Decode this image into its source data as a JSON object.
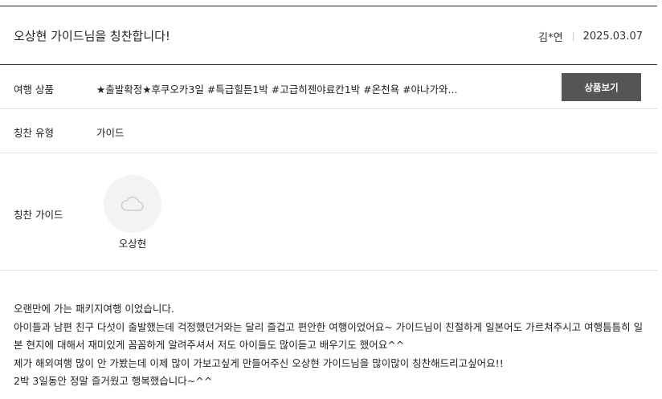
{
  "review": {
    "title": "오상현 가이드님을 칭찬합니다!",
    "author": "김*연",
    "date": "2025.03.07"
  },
  "details": {
    "product_label": "여행 상품",
    "product_value": "★출발확정★후쿠오카3일 #특급힐튼1박 #고급히젠야료칸1박 #온천욕 #야나가와...",
    "product_button": "상품보기",
    "type_label": "칭찬 유형",
    "type_value": "가이드",
    "guide_label": "칭찬 가이드",
    "guide_name": "오상현",
    "avatar_icon": "cloud-icon"
  },
  "content": {
    "lines": [
      "오랜만에 가는 패키지여행 이었습니다.",
      "아이들과 남편 친구 다섯이 출발했는데 걱정했던거와는 달리 즐겁고 편안한 여행이었어요~ 가이드님이 친절하게 일본어도 가르쳐주시고 여행틈틈히 일",
      "본 현지에 대해서 재미있게 꼼꼼하게 알려주셔서 저도 아이들도 많이듣고 배우기도 했어요^^",
      "제가 해외여행 많이 안 가봤는데 이제 많이 가보고싶게 만들어주신 오상현 가이드님을 많이많이 칭찬해드리고싶어요!!",
      "2박 3일동안 정말 즐거웠고 행복했습니다~^^"
    ]
  },
  "colors": {
    "button_bg": "#555555",
    "avatar_bg": "#f3f3f3",
    "divider": "#e2e2e2"
  }
}
